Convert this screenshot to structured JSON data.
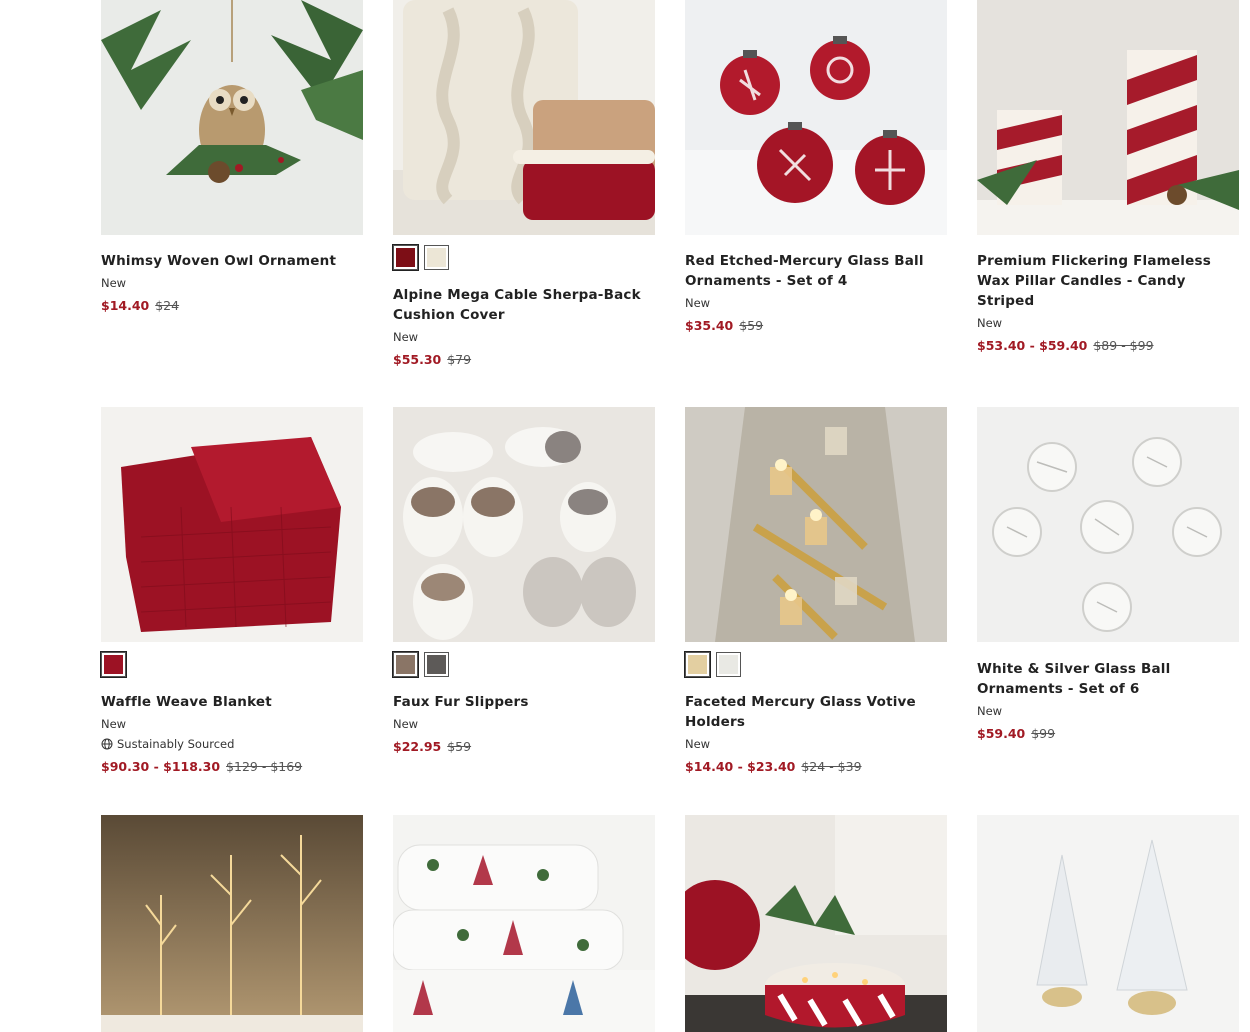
{
  "products": [
    {
      "title": "Whimsy Woven Owl Ornament",
      "badge": "New",
      "sale": "$14.40",
      "original": "$24",
      "swatches": []
    },
    {
      "title": "Alpine Mega Cable Sherpa-Back Cushion Cover",
      "badge": "New",
      "sale": "$55.30",
      "original": "$79",
      "swatches": [
        "#7d0e16",
        "#ece6d6"
      ]
    },
    {
      "title": "Red Etched-Mercury Glass Ball Ornaments - Set of 4",
      "badge": "New",
      "sale": "$35.40",
      "original": "$59",
      "swatches": []
    },
    {
      "title": "Premium Flickering Flameless Wax Pillar Candles - Candy Striped",
      "badge": "New",
      "sale": "$53.40 - $59.40",
      "original": "$89 - $99",
      "swatches": []
    },
    {
      "title": "Waffle Weave Blanket",
      "badge": "New",
      "sustainability": "Sustainably Sourced",
      "sale": "$90.30 - $118.30",
      "original": "$129 - $169",
      "swatches": [
        "#9c1224"
      ]
    },
    {
      "title": "Faux Fur Slippers",
      "badge": "New",
      "sale": "$22.95",
      "original": "$59",
      "swatches": [
        "#8a7566",
        "#5d5a58"
      ]
    },
    {
      "title": "Faceted Mercury Glass Votive Holders",
      "badge": "New",
      "sale": "$14.40 - $23.40",
      "original": "$24 - $39",
      "swatches": [
        "#e3cfa1",
        "#e9e9e4"
      ]
    },
    {
      "title": "White & Silver Glass Ball Ornaments - Set of 6",
      "badge": "New",
      "sale": "$59.40",
      "original": "$99",
      "swatches": []
    }
  ],
  "colors": {
    "sale_price": "#a11a24"
  }
}
